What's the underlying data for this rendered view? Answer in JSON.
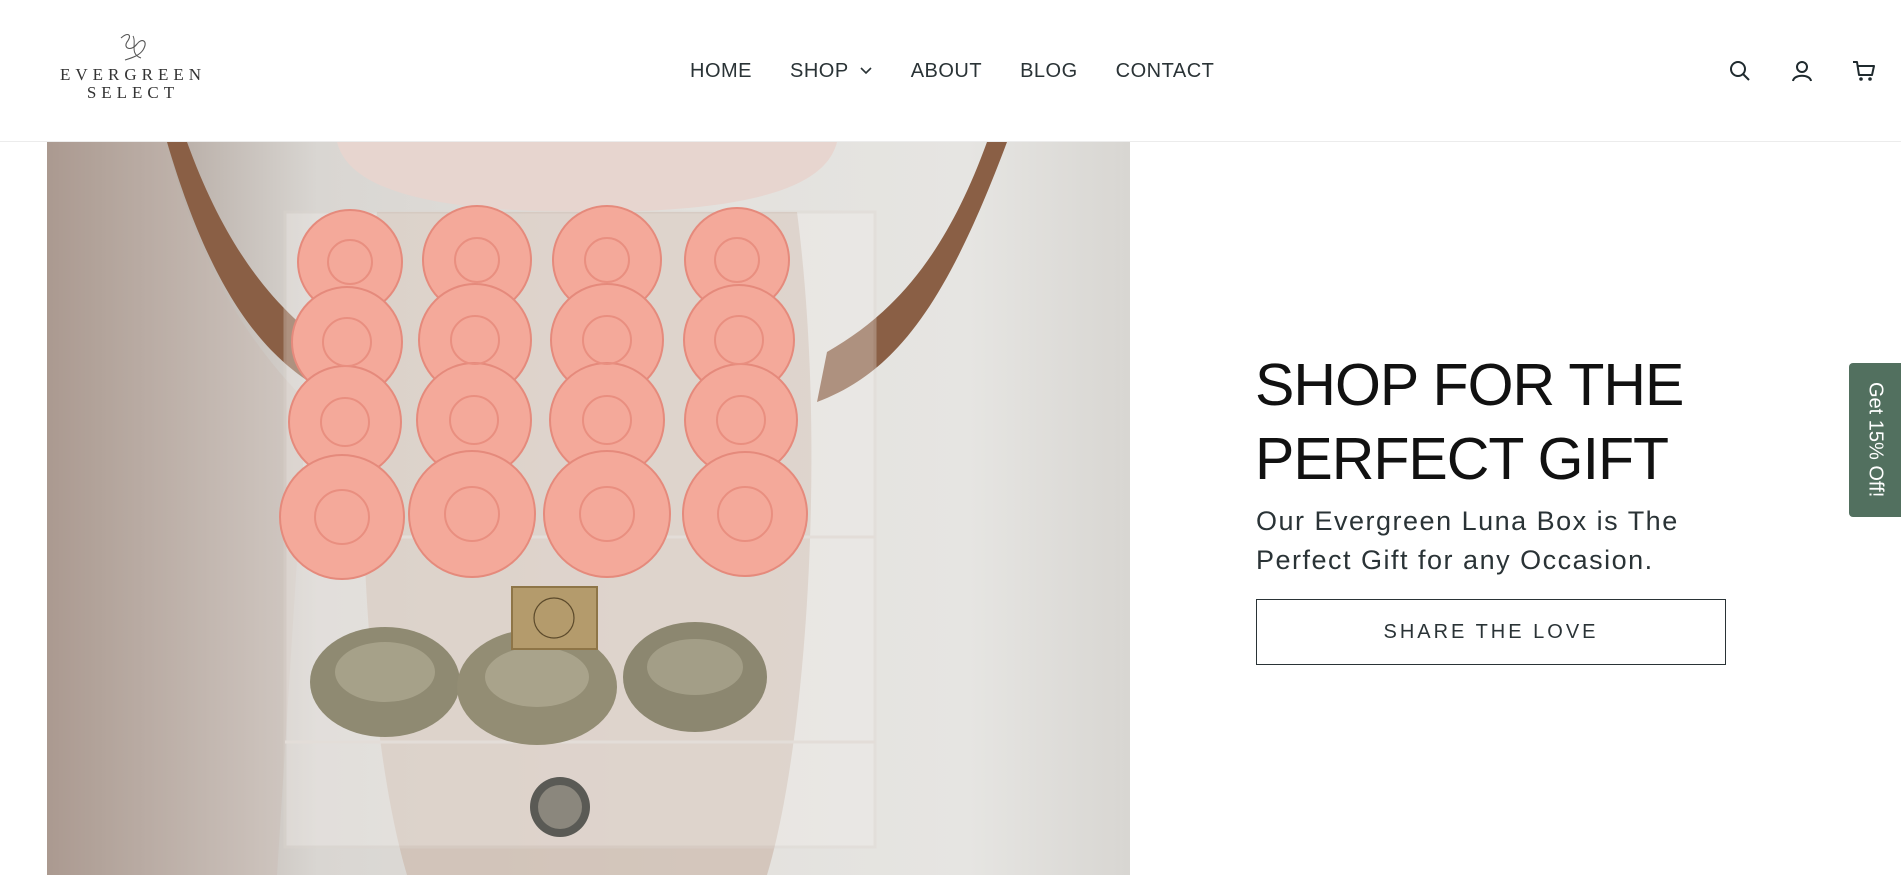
{
  "brand": {
    "logo_line1": "EVERGREEN",
    "logo_line2": "SELECT",
    "logo_monogram": "ES"
  },
  "nav": {
    "items": [
      {
        "label": "HOME"
      },
      {
        "label": "SHOP"
      },
      {
        "label": "ABOUT"
      },
      {
        "label": "BLOG"
      },
      {
        "label": "CONTACT"
      }
    ]
  },
  "header_icons": [
    "search-icon",
    "account-icon",
    "cart-icon"
  ],
  "hero": {
    "title_line1": "SHOP FOR THE",
    "title_line2": "PERFECT GIFT",
    "subtitle": "Our Evergreen Luna Box is The Perfect Gift for any Occasion.",
    "cta_label": "SHARE THE LOVE",
    "image_subject": "pink-roses-acrylic-box"
  },
  "side_tab": {
    "label": "Get 15% Off!"
  },
  "colors": {
    "accent_green": "#52705f",
    "text_dark": "#2a3336",
    "rose_pink": "#f4a99a"
  }
}
